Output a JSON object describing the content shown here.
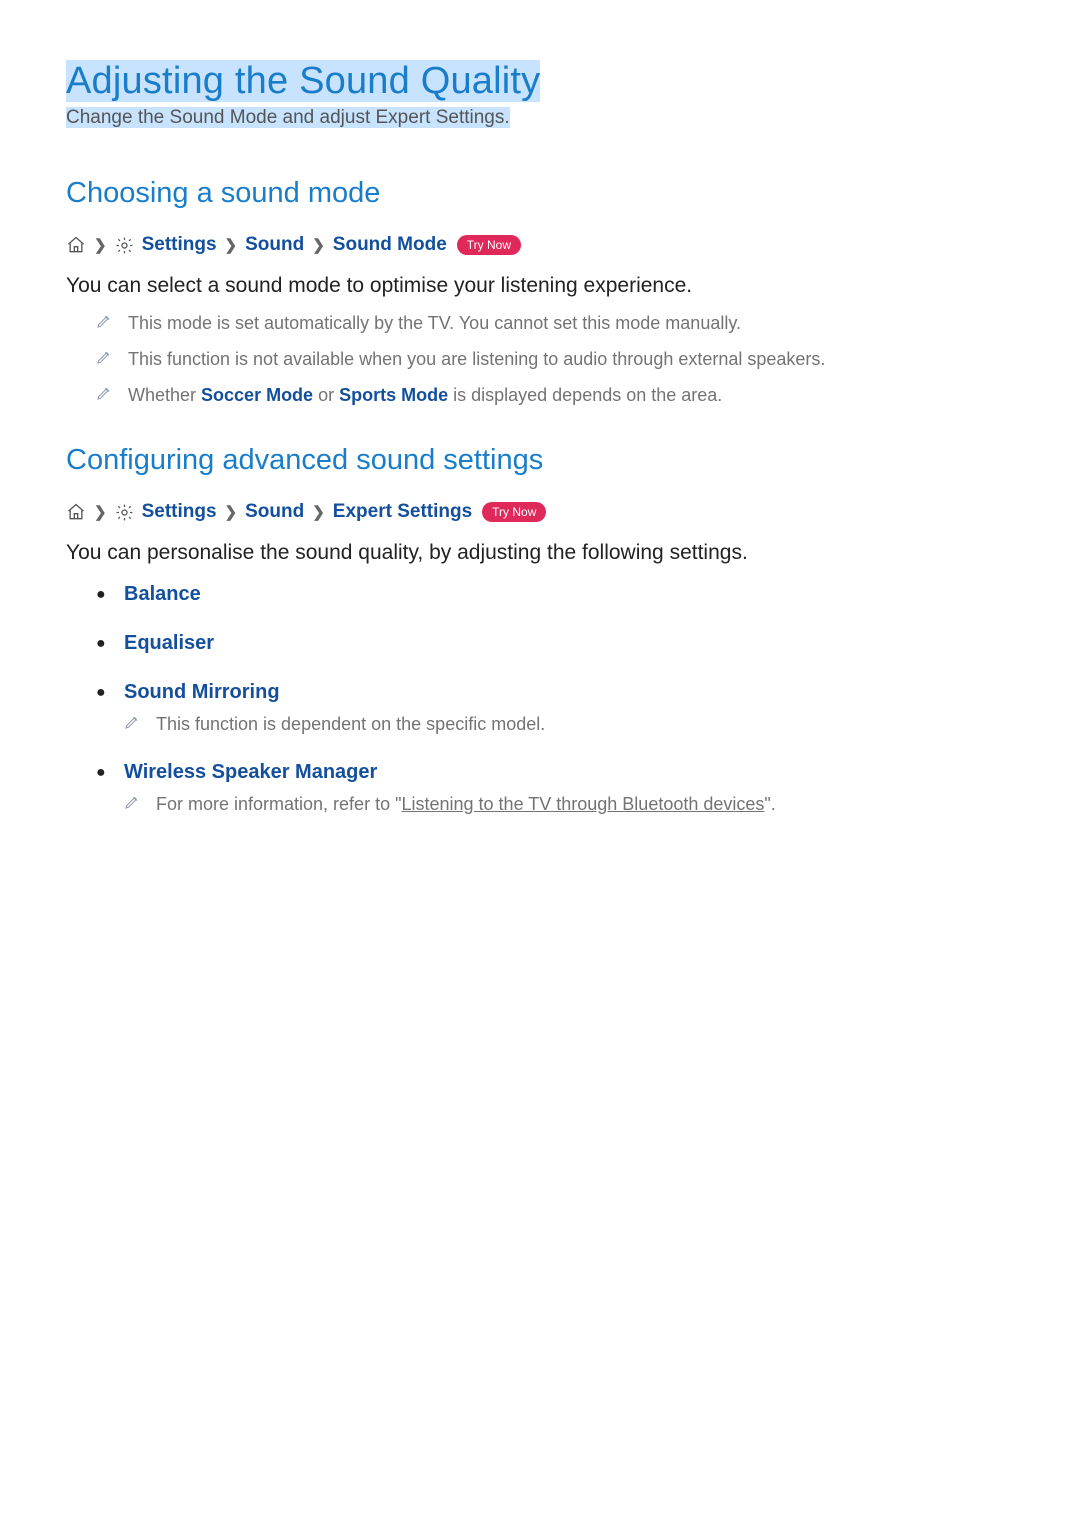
{
  "page": {
    "title": "Adjusting the Sound Quality",
    "subtitle": "Change the Sound Mode and adjust Expert Settings."
  },
  "section1": {
    "heading": "Choosing a sound mode",
    "crumb": {
      "settings": "Settings",
      "sound": "Sound",
      "sound_mode": "Sound Mode",
      "try_now": "Try Now"
    },
    "intro": "You can select a sound mode to optimise your listening experience.",
    "notes": [
      {
        "text": "This mode is set automatically by the TV. You cannot set this mode manually."
      },
      {
        "text": "This function is not available when you are listening to audio through external speakers."
      },
      {
        "pre": "Whether ",
        "link1": "Soccer Mode",
        "mid": " or ",
        "link2": "Sports Mode",
        "post": " is displayed depends on the area."
      }
    ]
  },
  "section2": {
    "heading": "Configuring advanced sound settings",
    "crumb": {
      "settings": "Settings",
      "sound": "Sound",
      "expert": "Expert Settings",
      "try_now": "Try Now"
    },
    "intro": "You can personalise the sound quality, by adjusting the following settings.",
    "items": {
      "balance": "Balance",
      "equaliser": "Equaliser",
      "sound_mirroring": "Sound Mirroring",
      "sound_mirroring_note": "This function is dependent on the specific model.",
      "wireless": "Wireless Speaker Manager",
      "wireless_note_pre": "For more information, refer to \"",
      "wireless_note_link": "Listening to the TV through Bluetooth devices",
      "wireless_note_post": "\"."
    }
  }
}
